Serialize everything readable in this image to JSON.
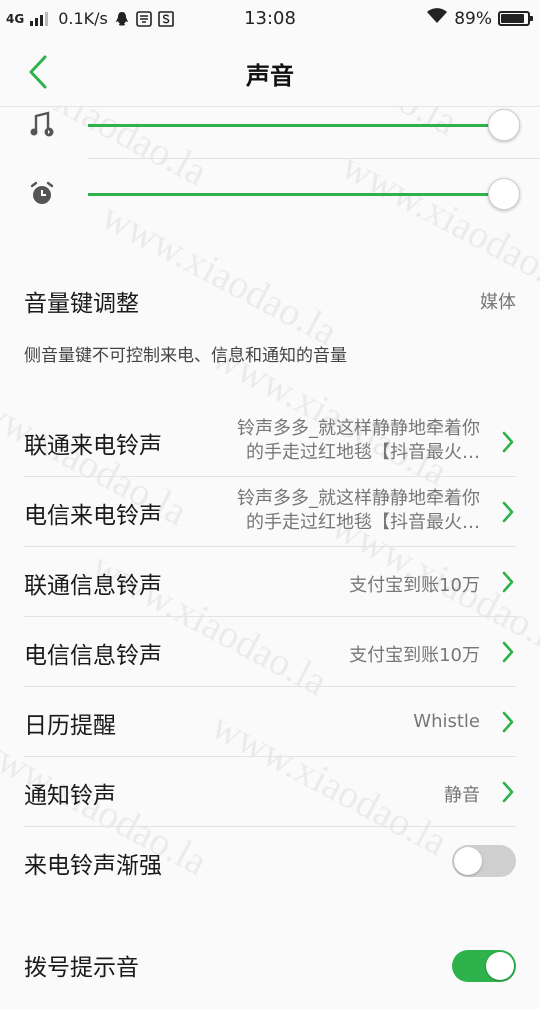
{
  "status_bar": {
    "network": "4G",
    "speed": "0.1K/s",
    "time": "13:08",
    "battery": "89%",
    "battery_level": 0.89
  },
  "header": {
    "title": "声音"
  },
  "sliders": [
    {
      "icon": "music-note-icon",
      "level": 1.0
    },
    {
      "icon": "alarm-clock-icon",
      "level": 1.0
    }
  ],
  "volume_key": {
    "label": "音量键调整",
    "value": "媒体"
  },
  "note": "侧音量键不可控制来电、信息和通知的音量",
  "rows": [
    {
      "label": "联通来电铃声",
      "value_line1": "铃声多多_就这样静静地牵着你",
      "value_line2": "的手走过红地毯【抖音最火…"
    },
    {
      "label": "电信来电铃声",
      "value_line1": "铃声多多_就这样静静地牵着你",
      "value_line2": "的手走过红地毯【抖音最火…"
    },
    {
      "label": "联通信息铃声",
      "value": "支付宝到账10万"
    },
    {
      "label": "电信信息铃声",
      "value": "支付宝到账10万"
    },
    {
      "label": "日历提醒",
      "value": "Whistle"
    },
    {
      "label": "通知铃声",
      "value": "静音"
    }
  ],
  "toggles": [
    {
      "label": "来电铃声渐强",
      "state": "off"
    },
    {
      "label": "拨号提示音",
      "state": "on"
    }
  ],
  "colors": {
    "accent": "#2eb24b",
    "divider": "#e3e3e3"
  },
  "watermark": "www.xiaodao.la"
}
